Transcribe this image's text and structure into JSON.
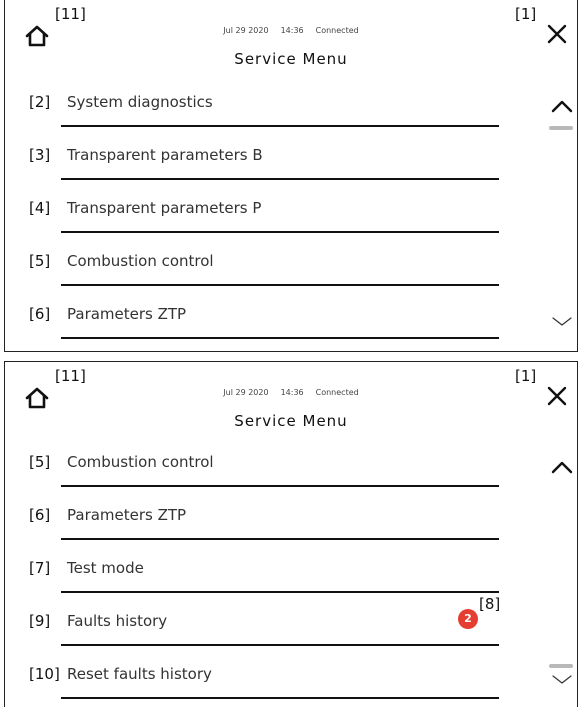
{
  "screens": [
    {
      "home_num": "[11]",
      "close_num": "[1]",
      "status": {
        "date": "Jul 29 2020",
        "time": "14:36",
        "connection": "Connected"
      },
      "title": "Service Menu",
      "items": [
        {
          "num": "[2]",
          "label": "System diagnostics"
        },
        {
          "num": "[3]",
          "label": "Transparent parameters B"
        },
        {
          "num": "[4]",
          "label": "Transparent parameters P"
        },
        {
          "num": "[5]",
          "label": "Combustion control"
        },
        {
          "num": "[6]",
          "label": "Parameters ZTP"
        }
      ],
      "scroll_position": "top"
    },
    {
      "home_num": "[11]",
      "close_num": "[1]",
      "status": {
        "date": "Jul 29 2020",
        "time": "14:36",
        "connection": "Connected"
      },
      "title": "Service Menu",
      "items": [
        {
          "num": "[5]",
          "label": "Combustion control"
        },
        {
          "num": "[6]",
          "label": "Parameters ZTP"
        },
        {
          "num": "[7]",
          "label": "Test mode"
        },
        {
          "num": "[9]",
          "label": "Faults history"
        },
        {
          "num": "[10]",
          "label": "Reset faults history"
        }
      ],
      "badge": {
        "count": "2",
        "num": "[8]"
      },
      "scroll_position": "bottom"
    }
  ],
  "colors": {
    "badge": "#e53e30",
    "scroll_indicator": "#b9b9b9",
    "lines": "#111111"
  },
  "icons": [
    "home-icon",
    "close-icon",
    "chevron-up-icon",
    "chevron-down-icon"
  ]
}
